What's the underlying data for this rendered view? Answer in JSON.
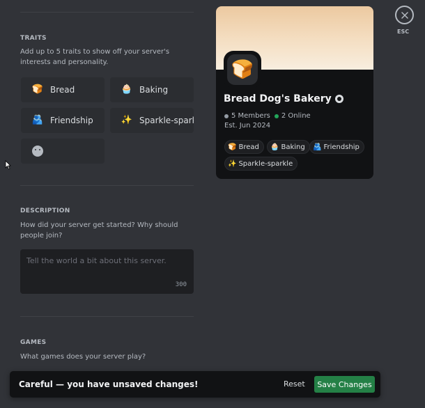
{
  "traits_section": {
    "title": "TRAITS",
    "description": "Add up to 5 traits to show off your server's interests and personality.",
    "items": [
      {
        "emoji": "🍞",
        "label": "Bread"
      },
      {
        "emoji": "🧁",
        "label": "Baking"
      },
      {
        "emoji": "🫂",
        "label": "Friendship"
      },
      {
        "emoji": "✨",
        "label": "Sparkle-sparkle"
      },
      {
        "emoji": "smiley-icon",
        "label": ""
      }
    ]
  },
  "description_section": {
    "title": "DESCRIPTION",
    "description": "How did your server get started? Why should people join?",
    "placeholder": "Tell the world a bit about this server.",
    "char_count": "300"
  },
  "games_section": {
    "title": "GAMES",
    "description": "What games does your server play?"
  },
  "close": {
    "label": "ESC"
  },
  "preview": {
    "server_icon": "🍞",
    "server_name": "Bread Dog's Bakery",
    "members": "5 Members",
    "online": "2 Online",
    "established": "Est. Jun 2024",
    "traits": [
      {
        "emoji": "🍞",
        "label": "Bread"
      },
      {
        "emoji": "🧁",
        "label": "Baking"
      },
      {
        "emoji": "🫂",
        "label": "Friendship"
      },
      {
        "emoji": "✨",
        "label": "Sparkle-sparkle"
      }
    ],
    "colors": {
      "members_dot": "#949ba4",
      "online_dot": "#23a55a"
    }
  },
  "toast": {
    "message": "Careful — you have unsaved changes!",
    "reset_label": "Reset",
    "save_label": "Save Changes"
  }
}
